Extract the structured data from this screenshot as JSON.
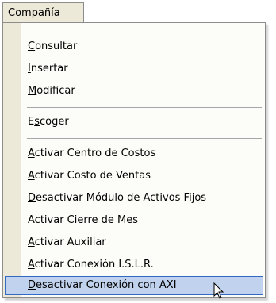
{
  "menubar": {
    "open_menu": {
      "pre": "",
      "mnemonic": "C",
      "post": "ompañía"
    }
  },
  "menu": {
    "items": [
      {
        "pre": "",
        "mnemonic": "C",
        "post": "onsultar"
      },
      {
        "pre": "",
        "mnemonic": "I",
        "post": "nsertar"
      },
      {
        "pre": "",
        "mnemonic": "M",
        "post": "odificar"
      },
      {
        "pre": "E",
        "mnemonic": "s",
        "post": "coger"
      },
      {
        "pre": "",
        "mnemonic": "A",
        "post": "ctivar Centro de Costos"
      },
      {
        "pre": "",
        "mnemonic": "A",
        "post": "ctivar Costo de Ventas"
      },
      {
        "pre": "",
        "mnemonic": "D",
        "post": "esactivar Módulo de Activos Fijos"
      },
      {
        "pre": "",
        "mnemonic": "A",
        "post": "ctivar Cierre de Mes"
      },
      {
        "pre": "",
        "mnemonic": "A",
        "post": "ctivar Auxiliar"
      },
      {
        "pre": "",
        "mnemonic": "A",
        "post": "ctivar Conexión I.S.L.R."
      },
      {
        "pre": "",
        "mnemonic": "D",
        "post": "esactivar Conexión con AXI"
      }
    ],
    "selected_index": 10
  },
  "cursor": {
    "icon": "arrow-cursor-icon"
  }
}
